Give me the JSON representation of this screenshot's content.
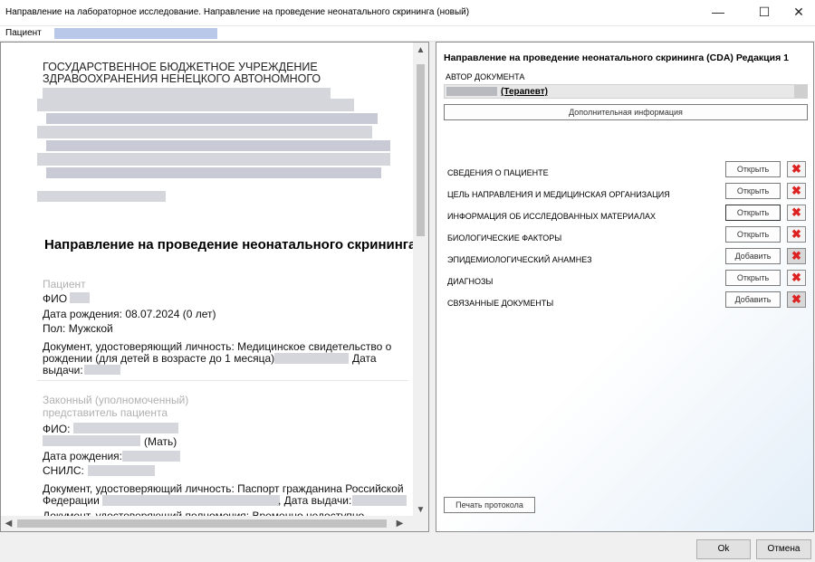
{
  "window": {
    "title": "Направление на лабораторное исследование. Направление на проведение неонатального скрининга (новый)",
    "minimize": "—",
    "maximize": "☐",
    "close": "✕"
  },
  "menu": {
    "patient": "Пациент"
  },
  "document": {
    "org_line1": "ГОСУДАРСТВЕННОЕ БЮДЖЕТНОЕ УЧРЕЖДЕНИЕ",
    "org_line2": "ЗДРАВООХРАНЕНИЯ НЕНЕЦКОГО АВТОНОМНОГО",
    "heading": "Направление на проведение неонатального скрининга",
    "patient_section": "Пациент",
    "fio_label": "ФИО",
    "birth": "Дата рождения: 08.07.2024 (0 лет)",
    "sex": "Пол: Мужской",
    "doc_line1": "Документ, удостоверяющий личность: Медицинское свидетельство о",
    "doc_line2": "рождении (для детей в возрасте до 1 месяца)",
    "doc_line2_tail": "Дата",
    "doc_line3": "выдачи:",
    "rep_section_line1": "Законный (уполномоченный)",
    "rep_section_line2": "представитель пациента",
    "rep_fio": "ФИО:",
    "rep_relation": "(Мать)",
    "rep_birth": "Дата рождения:",
    "rep_snils": "СНИЛС:",
    "rep_doc_line1": "Документ, удостоверяющий личность: Паспорт гражданина Российской",
    "rep_doc_line2": "Федерации",
    "rep_doc_line2_tail": ", Дата выдачи:",
    "rep_doc_line3": "Документ, удостоверяющий полномочия: Временно недоступно"
  },
  "panel": {
    "title": "Направление на проведение неонатального скрининга (CDA) Редакция 1",
    "author_label": "АВТОР ДОКУМЕНТА",
    "author_role": "(Терапевт)",
    "additional_info": "Дополнительная информация",
    "sections": [
      {
        "label": "СВЕДЕНИЯ О ПАЦИЕНТЕ",
        "action": "Открыть"
      },
      {
        "label": "ЦЕЛЬ НАПРАВЛЕНИЯ И МЕДИЦИНСКАЯ ОРГАНИЗАЦИЯ",
        "action": "Открыть"
      },
      {
        "label": "ИНФОРМАЦИЯ ОБ ИССЛЕДОВАННЫХ МАТЕРИАЛАХ",
        "action": "Открыть"
      },
      {
        "label": "БИОЛОГИЧЕСКИЕ ФАКТОРЫ",
        "action": "Открыть"
      },
      {
        "label": "ЭПИДЕМИОЛОГИЧЕСКИЙ АНАМНЕЗ",
        "action": "Добавить"
      },
      {
        "label": "ДИАГНОЗЫ",
        "action": "Открыть"
      },
      {
        "label": "СВЯЗАННЫЕ ДОКУМЕНТЫ",
        "action": "Добавить"
      }
    ],
    "delete_glyph": "✖",
    "print": "Печать протокола"
  },
  "footer": {
    "ok": "Ok",
    "cancel": "Отмена"
  }
}
